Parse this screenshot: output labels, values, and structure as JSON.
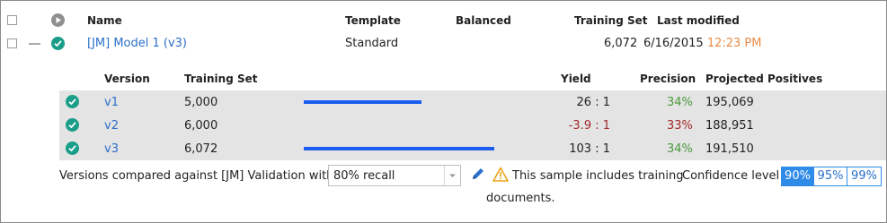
{
  "header": {
    "name": "Name",
    "template": "Template",
    "balanced": "Balanced",
    "training_set": "Training Set",
    "last_modified": "Last modified"
  },
  "model": {
    "name": "[JM] Model 1 (v3)",
    "template": "Standard",
    "training_set": "6,072",
    "date": "6/16/2015",
    "time": "12:23 PM"
  },
  "versions_header": {
    "version": "Version",
    "training_set": "Training Set",
    "yield": "Yield",
    "precision": "Precision",
    "projected_positives": "Projected Positives"
  },
  "versions": [
    {
      "name": "v1",
      "training_set": "5,000",
      "bar_fraction": 0.62,
      "yield": "26 : 1",
      "precision": "34%",
      "projected": "195,069"
    },
    {
      "name": "v2",
      "training_set": "6,000",
      "bar_fraction": 0,
      "yield": "-3.9 : 1",
      "precision": "33%",
      "projected": "188,951"
    },
    {
      "name": "v3",
      "training_set": "6,072",
      "bar_fraction": 1.0,
      "yield": "103 : 1",
      "precision": "34%",
      "projected": "191,510"
    }
  ],
  "footer": {
    "compared_text": "Versions compared against [JM] Validation with",
    "recall_value": "80% recall",
    "warning_line1": "This sample includes training",
    "warning_line2": "documents.",
    "confidence_label": "Confidence level",
    "confidence_options": [
      "90%",
      "95%",
      "99%"
    ],
    "confidence_selected": "90%"
  },
  "colors": {
    "accent": "#2f8be8",
    "check_teal": "#1a9e8a",
    "bar_blue": "#1a5ef0",
    "precision_green": "#4c9a3d",
    "yield_negative": "#a32a2a",
    "time_orange": "#e88a45",
    "warning": "#e8a317"
  }
}
